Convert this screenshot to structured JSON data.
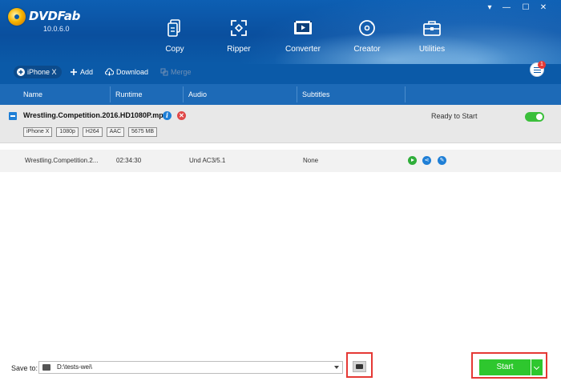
{
  "app": {
    "name": "DVDFab",
    "version": "10.0.6.0"
  },
  "window_controls": {
    "pin": "▾",
    "minimize": "—",
    "maximize": "☐",
    "close": "✕"
  },
  "nav": [
    {
      "label": "Copy",
      "icon": "copy-icon"
    },
    {
      "label": "Ripper",
      "icon": "ripper-icon"
    },
    {
      "label": "Converter",
      "icon": "converter-icon"
    },
    {
      "label": "Creator",
      "icon": "creator-icon"
    },
    {
      "label": "Utilities",
      "icon": "utilities-icon"
    }
  ],
  "toolbar": {
    "profile": "iPhone X",
    "add": "Add",
    "download": "Download",
    "merge": "Merge",
    "notification_count": "1"
  },
  "columns": {
    "name": "Name",
    "runtime": "Runtime",
    "audio": "Audio",
    "subtitles": "Subtitles"
  },
  "title": {
    "file": "Wrestling.Competition.2016.HD1080P.mp4",
    "tags": [
      "iPhone X",
      "1080p",
      "H264",
      "AAC",
      "5675 MB"
    ],
    "status": "Ready to Start"
  },
  "track": {
    "name": "Wrestling.Competition.2...",
    "runtime": "02:34:30",
    "audio": "Und AC3/5.1",
    "subtitles": "None"
  },
  "footer": {
    "save_label": "Save to:",
    "save_path": "D:\\tests-wei\\",
    "start_label": "Start"
  },
  "colors": {
    "header_blue": "#0b5aa8",
    "start_green": "#2ec72e",
    "highlight_red": "#e53935"
  }
}
